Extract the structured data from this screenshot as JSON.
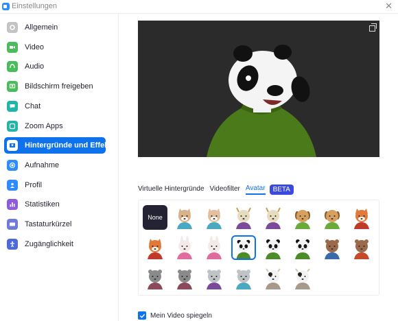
{
  "window": {
    "title": "Einstellungen"
  },
  "sidebar": {
    "items": [
      {
        "label": "Allgemein",
        "icon": "gear-icon",
        "color": "#c4c4c4"
      },
      {
        "label": "Video",
        "icon": "video-icon",
        "color": "#4cbb5c"
      },
      {
        "label": "Audio",
        "icon": "headphones-icon",
        "color": "#4cbb5c"
      },
      {
        "label": "Bildschirm freigeben",
        "icon": "share-screen-icon",
        "color": "#4cbb5c"
      },
      {
        "label": "Chat",
        "icon": "chat-icon",
        "color": "#22b4a8"
      },
      {
        "label": "Zoom Apps",
        "icon": "apps-icon",
        "color": "#22b4a8"
      },
      {
        "label": "Hintergründe und Effekte",
        "icon": "background-icon",
        "color": "#0e72ed",
        "active": true
      },
      {
        "label": "Aufnahme",
        "icon": "record-icon",
        "color": "#2d8cff"
      },
      {
        "label": "Profil",
        "icon": "profile-icon",
        "color": "#2d8cff"
      },
      {
        "label": "Statistiken",
        "icon": "statistics-icon",
        "color": "#8f5bd6"
      },
      {
        "label": "Tastaturkürzel",
        "icon": "keyboard-icon",
        "color": "#6e7bd8"
      },
      {
        "label": "Zugänglichkeit",
        "icon": "accessibility-icon",
        "color": "#4e6ad8"
      }
    ]
  },
  "tabs": [
    {
      "label": "Virtuelle Hintergründe"
    },
    {
      "label": "Videofilter"
    },
    {
      "label": "Avatar",
      "active": true
    }
  ],
  "beta_label": "BETA",
  "avatars": {
    "none_label": "None",
    "selected_index": 11,
    "items": [
      {
        "animal": "none"
      },
      {
        "animal": "cat",
        "fur": "#d9b28c",
        "shirt": "#4aa8c0"
      },
      {
        "animal": "cat",
        "fur": "#e1bfa0",
        "shirt": "#4aa8c0"
      },
      {
        "animal": "goat",
        "fur": "#e8dcc0",
        "shirt": "#7b4b9a"
      },
      {
        "animal": "goat",
        "fur": "#e8dcc0",
        "shirt": "#7b4b9a"
      },
      {
        "animal": "dog",
        "fur": "#d6a05f",
        "shirt": "#6aaa3a"
      },
      {
        "animal": "dog",
        "fur": "#d6a05f",
        "shirt": "#6aaa3a"
      },
      {
        "animal": "fox",
        "fur": "#e07a3a",
        "shirt": "#c0392b"
      },
      {
        "animal": "fox",
        "fur": "#e07a3a",
        "shirt": "#c0392b"
      },
      {
        "animal": "rabbit",
        "fur": "#f4eaea",
        "shirt": "#e06c9f"
      },
      {
        "animal": "rabbit",
        "fur": "#f4eaea",
        "shirt": "#e06c9f"
      },
      {
        "animal": "panda",
        "fur": "#f2f2f2",
        "shirt": "#4c8a2a"
      },
      {
        "animal": "panda",
        "fur": "#f2f2f2",
        "shirt": "#4c8a2a"
      },
      {
        "animal": "panda",
        "fur": "#f2f2f2",
        "shirt": "#4c8a2a"
      },
      {
        "animal": "bear",
        "fur": "#9a6a4a",
        "shirt": "#3a6aa8"
      },
      {
        "animal": "bear",
        "fur": "#9a6a4a",
        "shirt": "#c44a2a"
      },
      {
        "animal": "raccoon",
        "fur": "#8a8a8a",
        "shirt": "#8a4a5a"
      },
      {
        "animal": "raccoon",
        "fur": "#8a8a8a",
        "shirt": "#8a4a5a"
      },
      {
        "animal": "koala",
        "fur": "#bfc3c8",
        "shirt": "#7a4a9a"
      },
      {
        "animal": "koala",
        "fur": "#bfc3c8",
        "shirt": "#4aa8c0"
      },
      {
        "animal": "cow",
        "fur": "#f2f2f2",
        "shirt": "#a89a8a"
      },
      {
        "animal": "cow",
        "fur": "#f2f2f2",
        "shirt": "#a89a8a"
      }
    ]
  },
  "mirror": {
    "label": "Mein Video spiegeln",
    "checked": true
  }
}
